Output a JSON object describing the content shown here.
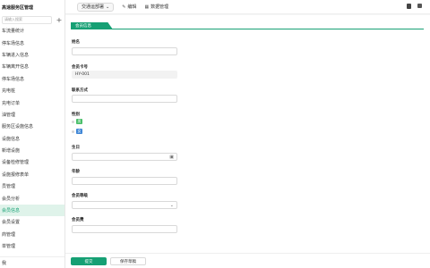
{
  "sidebar": {
    "brand": "高速服务区管理",
    "search_placeholder": "请输入搜索",
    "add_icon": "plus-icon",
    "items": [
      {
        "label": "车流量统计",
        "active": false
      },
      {
        "label": "停车场信息",
        "active": false
      },
      {
        "label": "车辆进入信息",
        "active": false
      },
      {
        "label": "车辆离开信息",
        "active": false
      },
      {
        "label": "停车场信息",
        "active": false
      },
      {
        "label": "充电桩",
        "active": false
      },
      {
        "label": "充电订单",
        "active": false
      },
      {
        "label": "油管理",
        "active": false
      },
      {
        "label": "服务区设施信息",
        "active": false
      },
      {
        "label": "设施信息",
        "active": false
      },
      {
        "label": "新增设施",
        "active": false
      },
      {
        "label": "设备检修管理",
        "active": false
      },
      {
        "label": "设施报修表单",
        "active": false
      },
      {
        "label": "员管理",
        "active": false
      },
      {
        "label": "会员分析",
        "active": false
      },
      {
        "label": "会员信息",
        "active": true
      },
      {
        "label": "会员设置",
        "active": false
      },
      {
        "label": "商管理",
        "active": false
      },
      {
        "label": "单管理",
        "active": false
      }
    ],
    "footer": "我"
  },
  "topbar": {
    "dropdown_label": "交通运部署",
    "edit_label": "编辑",
    "data_label": "数据管理",
    "edit_icon": "pencil-icon",
    "data_icon": "table-icon",
    "right_icons": [
      "clipboard-icon",
      "settings-icon"
    ]
  },
  "form": {
    "tab_title": "会员信息",
    "fields": {
      "name": {
        "label": "姓名",
        "value": ""
      },
      "member_no": {
        "label": "会员卡号",
        "value": "HY-001"
      },
      "contact": {
        "label": "联系方式",
        "value": ""
      },
      "gender": {
        "label": "性别",
        "options": [
          "男",
          "女"
        ]
      },
      "birthday": {
        "label": "生日",
        "value": "",
        "icon": "calendar-icon"
      },
      "age": {
        "label": "年龄",
        "value": ""
      },
      "level": {
        "label": "会员等级",
        "value": "",
        "icon": "chevron-down-icon"
      },
      "fee": {
        "label": "会员费",
        "value": ""
      }
    }
  },
  "actions": {
    "submit_label": "提交",
    "save_draft_label": "保存草稿"
  }
}
